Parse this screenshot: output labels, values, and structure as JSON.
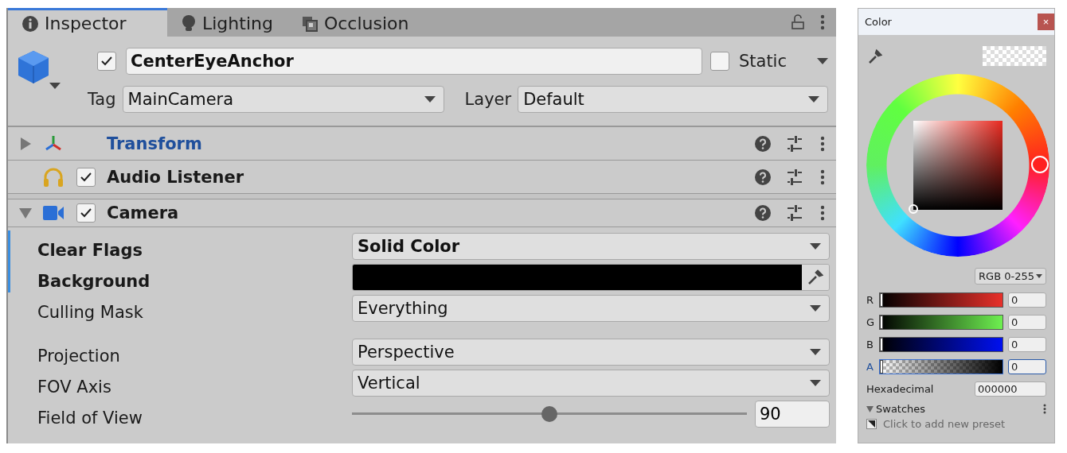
{
  "inspector": {
    "tabs": [
      {
        "label": "Inspector",
        "kind": "info",
        "selected": true
      },
      {
        "label": "Lighting",
        "kind": "bulb",
        "selected": false
      },
      {
        "label": "Occlusion",
        "kind": "occlusion",
        "selected": false
      }
    ],
    "header": {
      "active": true,
      "name": "CenterEyeAnchor",
      "static": false,
      "static_label": "Static",
      "tag_label": "Tag",
      "tag": "MainCamera",
      "layer_label": "Layer",
      "layer": "Default"
    },
    "components": [
      {
        "name": "Transform",
        "kind": "transform",
        "expanded": false,
        "highlighted": true
      },
      {
        "name": "Audio Listener",
        "kind": "audio",
        "enabled": true,
        "highlighted": false
      },
      {
        "name": "Camera",
        "kind": "camera",
        "expanded": true,
        "enabled": true,
        "highlighted": false
      }
    ],
    "properties": [
      {
        "label": "Clear Flags",
        "kind": "dropdown",
        "value": "Solid Color",
        "overridden": true,
        "spaced_before": false
      },
      {
        "label": "Background",
        "kind": "color",
        "color": "#000000",
        "overridden": true,
        "spaced_before": false
      },
      {
        "label": "Culling Mask",
        "kind": "dropdown",
        "value": "Everything",
        "overridden": false,
        "spaced_before": false
      },
      {
        "label": "Projection",
        "kind": "dropdown",
        "value": "Perspective",
        "overridden": false,
        "spaced_before": true
      },
      {
        "label": "FOV Axis",
        "kind": "dropdown",
        "value": "Vertical",
        "overridden": false,
        "spaced_before": false
      },
      {
        "label": "Field of View",
        "kind": "slider",
        "level": 0.5,
        "value": "90",
        "overridden": false,
        "spaced_before": false
      }
    ]
  },
  "color_picker": {
    "title": "Color",
    "close": "×",
    "mode": "RGB 0-255",
    "channels": [
      {
        "label": "R",
        "kind": "red",
        "level": 0,
        "value": "0",
        "focused": false
      },
      {
        "label": "G",
        "kind": "green",
        "level": 0,
        "value": "0",
        "focused": false
      },
      {
        "label": "B",
        "kind": "blue",
        "level": 0,
        "value": "0",
        "focused": false
      },
      {
        "label": "A",
        "kind": "alpha",
        "level": 0,
        "value": "0",
        "focused": true
      }
    ],
    "hex_label": "Hexadecimal",
    "hex": "000000",
    "swatches": {
      "label": "Swatches",
      "expanded": true,
      "hint": "Click to add new preset"
    }
  }
}
